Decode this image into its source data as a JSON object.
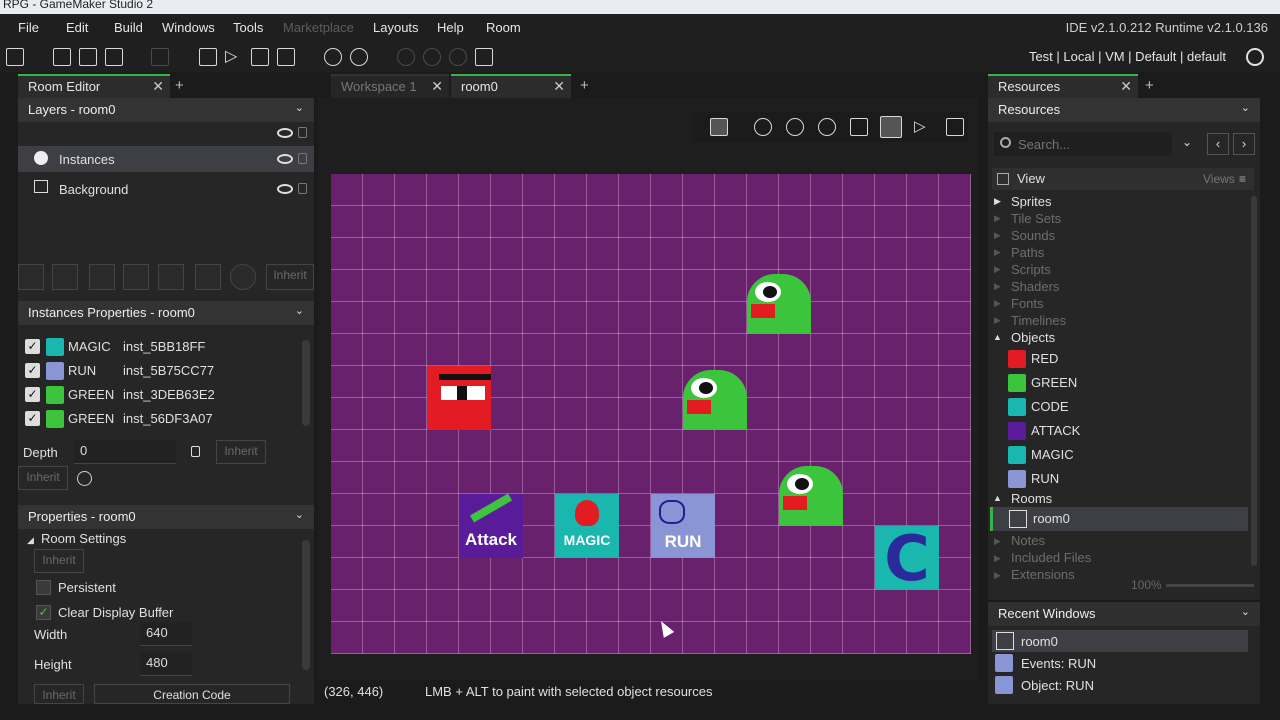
{
  "window": {
    "title": "RPG - GameMaker Studio 2"
  },
  "menubar": {
    "file": "File",
    "edit": "Edit",
    "build": "Build",
    "windows": "Windows",
    "tools": "Tools",
    "marketplace": "Marketplace",
    "layouts": "Layouts",
    "help": "Help",
    "room": "Room",
    "ide_version": "IDE v2.1.0.212 Runtime v2.1.0.136"
  },
  "toolbar": {
    "targets": "Test | Local | VM | Default | default"
  },
  "room_editor": {
    "tab": "Room Editor",
    "layers_title": "Layers - room0",
    "layers": [
      {
        "label": "Instances"
      },
      {
        "label": "Background"
      }
    ],
    "inherit_label": "Inherit",
    "instances_title": "Instances Properties - room0",
    "instances": [
      {
        "object": "MAGIC",
        "id": "inst_5BB18FF"
      },
      {
        "object": "RUN",
        "id": "inst_5B75CC77"
      },
      {
        "object": "GREEN",
        "id": "inst_3DEB63E2"
      },
      {
        "object": "GREEN",
        "id": "inst_56DF3A07"
      }
    ],
    "depth_label": "Depth",
    "depth_value": "0",
    "properties_title": "Properties - room0",
    "room_settings": "Room Settings",
    "persistent_label": "Persistent",
    "clear_buffer_label": "Clear Display Buffer",
    "width_label": "Width",
    "width_value": "640",
    "height_label": "Height",
    "height_value": "480",
    "creation_code": "Creation Code"
  },
  "workspace": {
    "tabs": [
      {
        "label": "Workspace 1"
      },
      {
        "label": "room0"
      }
    ],
    "room_labels": {
      "attack": "Attack",
      "magic": "MAGIC",
      "run": "RUN",
      "code": "C"
    }
  },
  "resources": {
    "tab": "Resources",
    "header": "Resources",
    "search_placeholder": "Search...",
    "view_label": "View",
    "views_label": "Views",
    "groups": [
      "Sprites",
      "Tile Sets",
      "Sounds",
      "Paths",
      "Scripts",
      "Shaders",
      "Fonts",
      "Timelines"
    ],
    "objects_label": "Objects",
    "objects": [
      "RED",
      "GREEN",
      "CODE",
      "ATTACK",
      "MAGIC",
      "RUN"
    ],
    "rooms_label": "Rooms",
    "room_item": "room0",
    "lower_groups": [
      "Notes",
      "Included Files",
      "Extensions"
    ],
    "zoom": "100%"
  },
  "recent": {
    "title": "Recent Windows",
    "items": [
      "room0",
      "Events: RUN",
      "Object: RUN"
    ]
  },
  "status": {
    "coords": "(326, 446)",
    "hint": "LMB + ALT to paint with selected object resources"
  },
  "colors": {
    "room_bg": "#69216e",
    "accent": "#37b34a"
  }
}
